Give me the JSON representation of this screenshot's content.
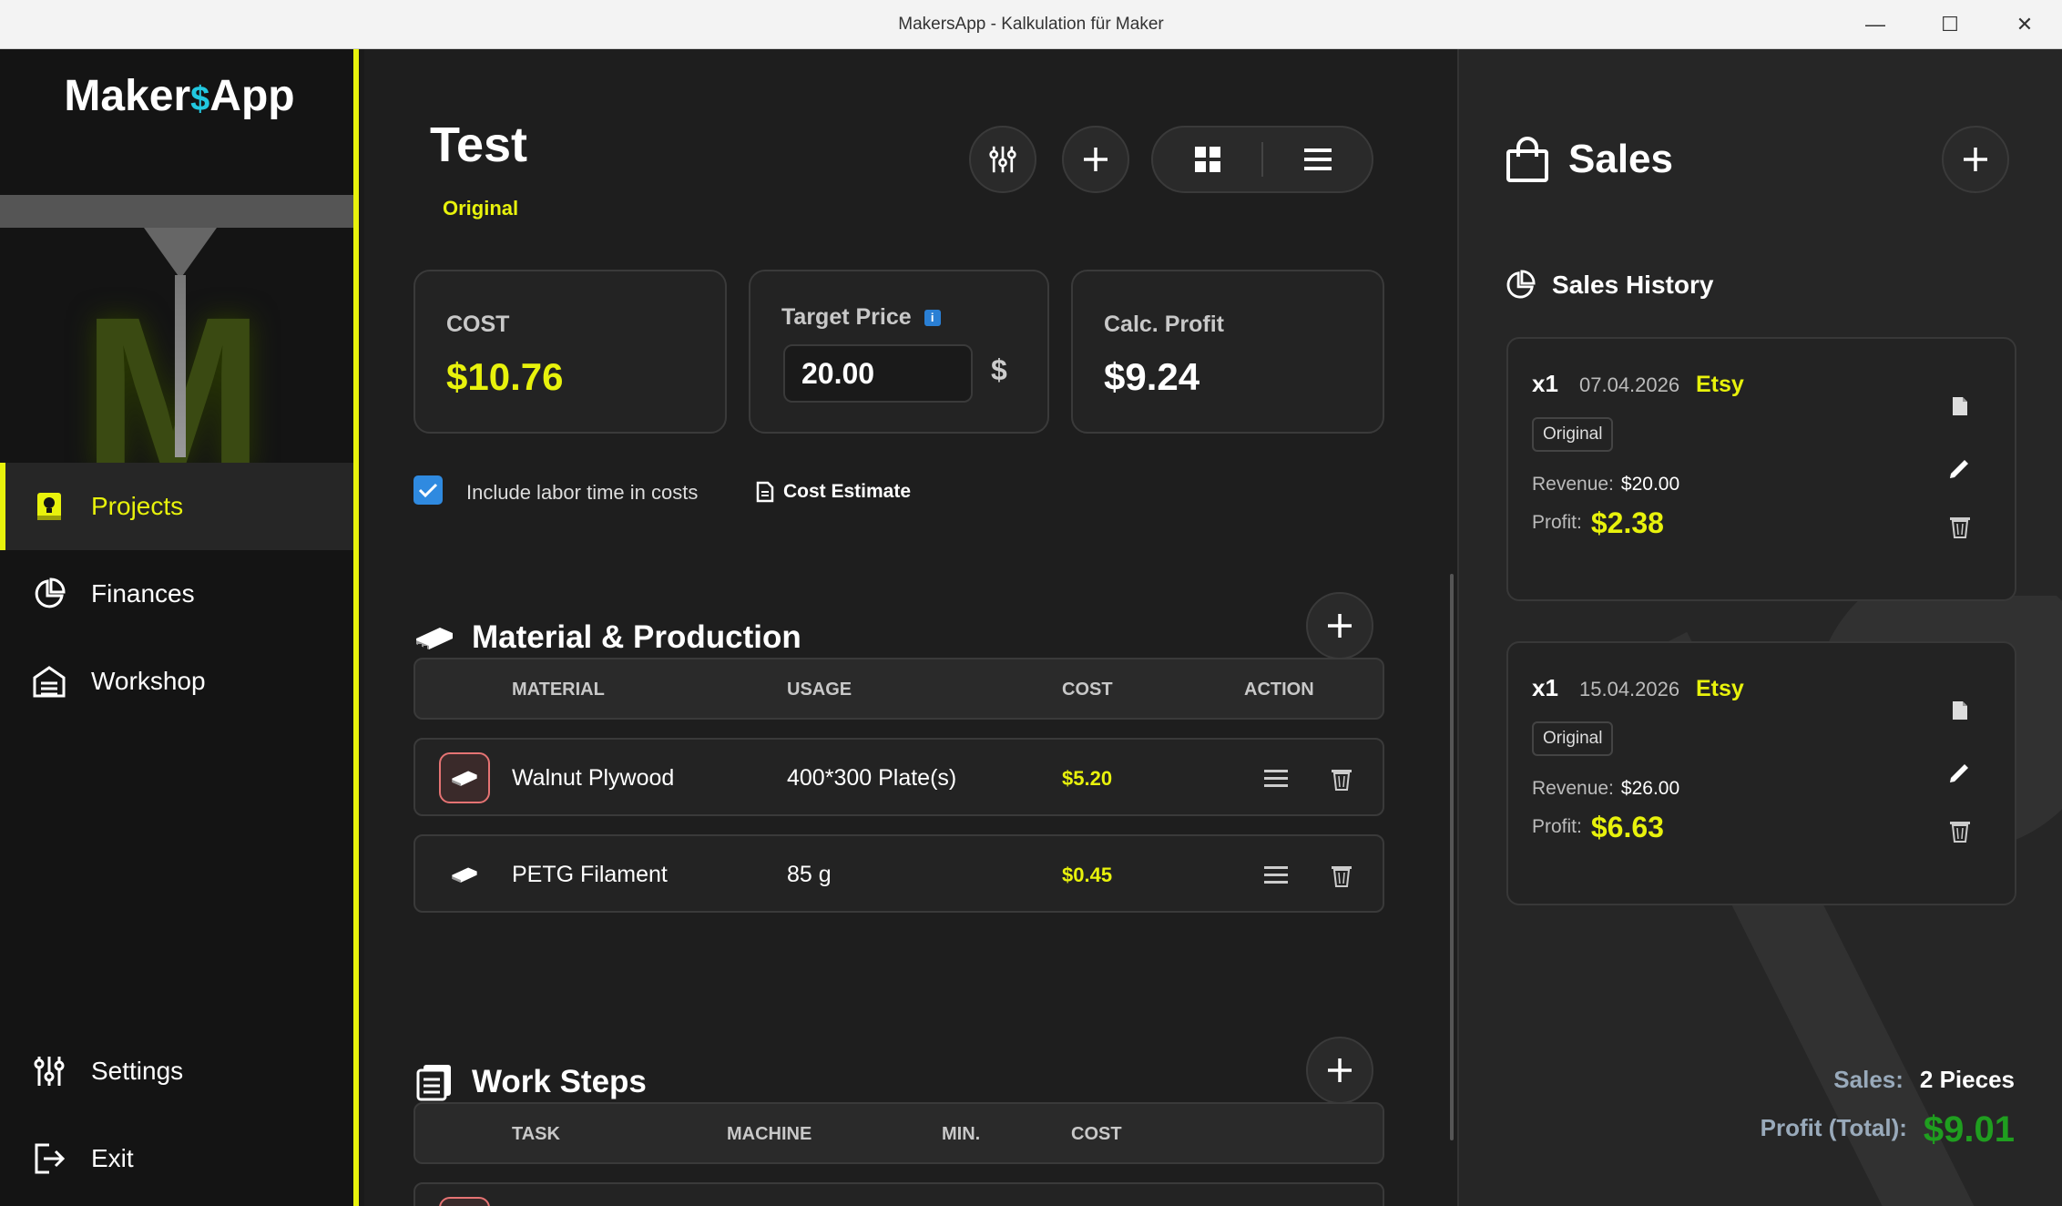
{
  "window": {
    "title": "MakersApp - Kalkulation für Maker",
    "minimize": "—",
    "maximize": "☐",
    "close": "✕"
  },
  "sidebar": {
    "logo_left": "Maker",
    "logo_dollar": "$",
    "logo_right": "App",
    "accent": "#e8f20c",
    "nav": [
      {
        "label": "Projects",
        "icon": "lightbulb-book-icon",
        "active": true
      },
      {
        "label": "Finances",
        "icon": "pie-chart-icon"
      },
      {
        "label": "Workshop",
        "icon": "garage-icon"
      }
    ],
    "bottom": [
      {
        "label": "Settings",
        "icon": "sliders-icon"
      },
      {
        "label": "Exit",
        "icon": "exit-icon"
      }
    ]
  },
  "project": {
    "title": "Test",
    "variant": "Original",
    "cost_label": "COST",
    "cost_value": "$10.76",
    "target_label": "Target Price",
    "target_info": "i",
    "target_value": "20.00",
    "currency": "$",
    "profit_label": "Calc. Profit",
    "profit_value": "$9.24",
    "labor_label": "Include labor time in costs",
    "labor_checked": true,
    "cost_estimate": "Cost Estimate"
  },
  "materials": {
    "title": "Material & Production",
    "headers": [
      "MATERIAL",
      "USAGE",
      "COST",
      "ACTION"
    ],
    "rows": [
      {
        "name": "Walnut Plywood",
        "usage": "400*300 Plate(s)",
        "cost": "$5.20"
      },
      {
        "name": "PETG Filament",
        "usage": "85 g",
        "cost": "$0.45"
      }
    ]
  },
  "worksteps": {
    "title": "Work Steps",
    "headers": [
      "TASK",
      "MACHINE",
      "MIN.",
      "COST"
    ]
  },
  "sales": {
    "title": "Sales",
    "history_title": "Sales History",
    "revenue_label": "Revenue:",
    "profit_label": "Profit:",
    "items": [
      {
        "qty": "x1",
        "date": "07.04.2026",
        "platform": "Etsy",
        "variant": "Original",
        "revenue": "$20.00",
        "profit": "$2.38"
      },
      {
        "qty": "x1",
        "date": "15.04.2026",
        "platform": "Etsy",
        "variant": "Original",
        "revenue": "$26.00",
        "profit": "$6.63"
      }
    ],
    "summary_sales_label": "Sales:",
    "summary_sales_value": "2 Pieces",
    "summary_profit_label": "Profit (Total):",
    "summary_profit_value": "$9.01"
  }
}
